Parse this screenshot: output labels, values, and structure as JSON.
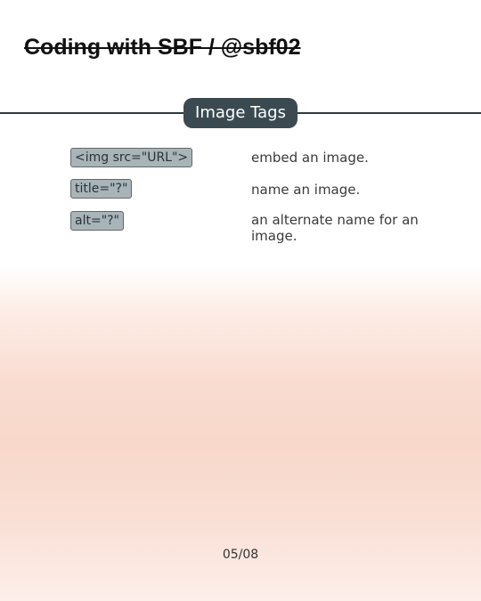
{
  "header": {
    "title": "Coding with SBF / @sbf02"
  },
  "section": {
    "title": "Image Tags"
  },
  "tags": [
    {
      "code": "<img src=\"URL\">",
      "description": "embed an image."
    },
    {
      "code": "title=\"?\"",
      "description": "name an image."
    },
    {
      "code": "alt=\"?\"",
      "description": "an alternate name for an image."
    }
  ],
  "footer": {
    "page": "05/08"
  },
  "colors": {
    "pill_background": "#3a4a50",
    "chip_background": "#a9b4b8",
    "gradient_peach": "#f8d8cb"
  }
}
